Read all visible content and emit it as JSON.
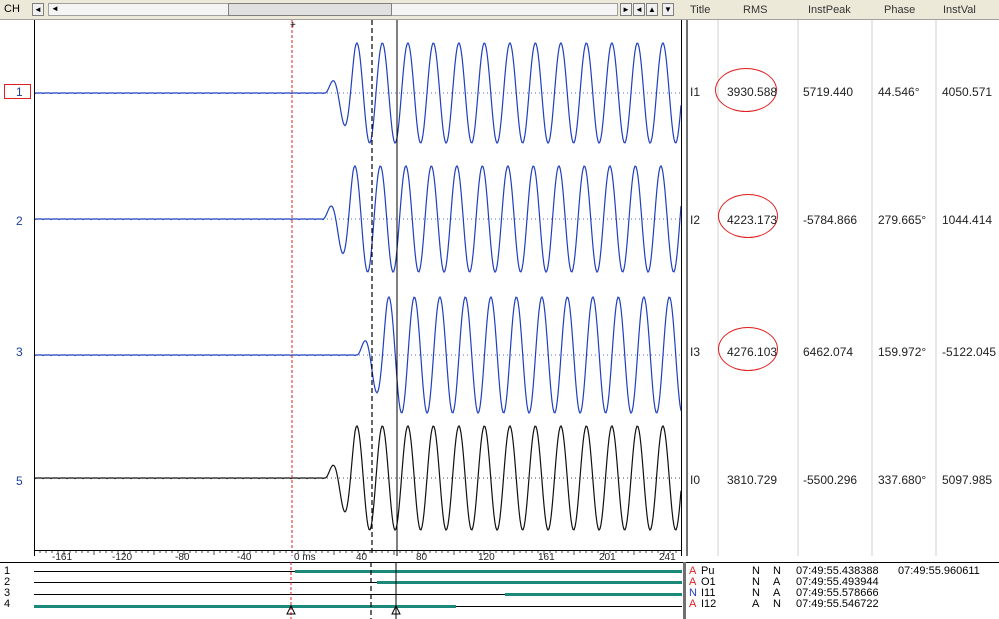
{
  "toolbar": {
    "ch_label": "CH",
    "nav_left_glyph": "◄",
    "nav_left2_glyph": "◄",
    "nav_right_glyph": "►",
    "nav_up_glyph": "▲",
    "nav_down_glyph": "▼"
  },
  "table_headers": [
    "Title",
    "RMS",
    "InstPeak",
    "Phase",
    "InstVal"
  ],
  "channels": [
    {
      "num": "1",
      "title": "I1",
      "rms": "3930.588",
      "instpeak": "5719.440",
      "phase": "44.546°",
      "instval": "4050.571"
    },
    {
      "num": "2",
      "title": "I2",
      "rms": "4223.173",
      "instpeak": "-5784.866",
      "phase": "279.665°",
      "instval": "1044.414"
    },
    {
      "num": "3",
      "title": "I3",
      "rms": "4276.103",
      "instpeak": "6462.074",
      "phase": "159.972°",
      "instval": "-5122.045"
    },
    {
      "num": "5",
      "title": "I0",
      "rms": "3810.729",
      "instpeak": "-5500.296",
      "phase": "337.680°",
      "instval": "5097.985"
    }
  ],
  "time_axis": {
    "labels": [
      "-161",
      "-120",
      "-80",
      "-40",
      "0 ms",
      "40",
      "80",
      "120",
      "161",
      "201",
      "241"
    ]
  },
  "digital": {
    "numbers": [
      "1",
      "2",
      "3",
      "4"
    ],
    "rows": [
      {
        "flag": "A",
        "name": "Pu",
        "c1": "N",
        "c2": "N",
        "time": "07:49:55.438388"
      },
      {
        "flag": "A",
        "name": "O1",
        "c1": "N",
        "c2": "A",
        "time": "07:49:55.493944"
      },
      {
        "flag": "N",
        "name": "I11",
        "c1": "N",
        "c2": "A",
        "time": "07:49:55.578666"
      },
      {
        "flag": "A",
        "name": "I12",
        "c1": "A",
        "c2": "N",
        "time": "07:49:55.546722"
      }
    ],
    "cursor_time": "07:49:55.960611"
  },
  "colors": {
    "wave_blue": "#1f3fbf",
    "wave_black": "#111111",
    "digital_active": "#1b8a7a",
    "cursor_red": "#e02020",
    "circle_red": "#e02020"
  }
}
